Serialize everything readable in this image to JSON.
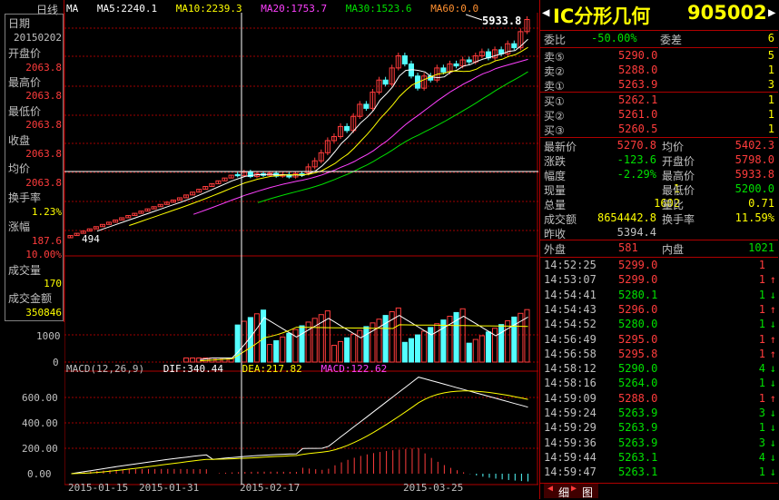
{
  "header": {
    "period_label": "日线",
    "ma_label": "MA",
    "ma5": "MA5:2240.1",
    "ma10": "MA10:2239.3",
    "ma20": "MA20:1753.7",
    "ma30": "MA30:1523.6",
    "ma60": "MA60:0.0",
    "high_marker": "5933.8",
    "low_marker": "494"
  },
  "left_panel": {
    "date_label": "日期",
    "date_value": "20150202",
    "open_label": "开盘价",
    "open_value": "2063.8",
    "high_label": "最高价",
    "high_value": "2063.8",
    "low_label": "最低价",
    "low_value": "2063.8",
    "close_label": "收盘",
    "close_value": "2063.8",
    "avg_label": "均价",
    "avg_value": "2063.8",
    "turnover_label": "换手率",
    "turnover_value": "1.23%",
    "change_label": "涨幅",
    "change_value": "187.6",
    "change_pct": "10.00%",
    "volume_label": "成交量",
    "volume_value": "170",
    "amount_label": "成交金额",
    "amount_value": "350846"
  },
  "volume_axis": [
    "1000",
    "0"
  ],
  "macd": {
    "label": "MACD(12,26,9)",
    "dif": "DIF:340.44",
    "dea": "DEA:217.82",
    "macd": "MACD:122.62",
    "axis": [
      "600.00",
      "400.00",
      "200.00",
      "0.00"
    ]
  },
  "date_axis": [
    "2015-01-15",
    "2015-01-31",
    "2015-02-17",
    "2015-03-25"
  ],
  "quote": {
    "name": "IC分形几何",
    "code": "905002",
    "webi_label": "委比",
    "webi_value": "-50.00%",
    "weicha_label": "委差",
    "weicha_value": "6",
    "asks": [
      {
        "label": "卖⑤",
        "price": "5290.0",
        "vol": "5"
      },
      {
        "label": "卖②",
        "price": "5288.0",
        "vol": "1"
      },
      {
        "label": "卖①",
        "price": "5263.9",
        "vol": "3"
      }
    ],
    "bids": [
      {
        "label": "买①",
        "price": "5262.1",
        "vol": "1"
      },
      {
        "label": "买②",
        "price": "5261.0",
        "vol": "1"
      },
      {
        "label": "买③",
        "price": "5260.5",
        "vol": "1"
      }
    ],
    "stats": [
      {
        "l1": "最新价",
        "v1": "5270.8",
        "l2": "均价",
        "v2": "5402.3"
      },
      {
        "l1": "涨跌",
        "v1": "-123.6",
        "l2": "开盘价",
        "v2": "5798.0"
      },
      {
        "l1": "幅度",
        "v1": "-2.29%",
        "l2": "最高价",
        "v2": "5933.8"
      },
      {
        "l1": "现量",
        "v1": "1",
        "l2": "最低价",
        "v2": "5200.0"
      },
      {
        "l1": "总量",
        "v1": "1602",
        "l2": "量比",
        "v2": "0.71"
      },
      {
        "l1": "成交额",
        "v1": "8654442.8",
        "l2": "换手率",
        "v2": "11.59%"
      },
      {
        "l1": "昨收",
        "v1": "5394.4",
        "l2": "",
        "v2": ""
      }
    ],
    "waipan_label": "外盘",
    "waipan_value": "581",
    "neipan_label": "内盘",
    "neipan_value": "1021",
    "ticks": [
      {
        "t": "14:52:25",
        "p": "5299.0",
        "v": "1",
        "d": ""
      },
      {
        "t": "14:53:07",
        "p": "5299.0",
        "v": "1",
        "d": "↑"
      },
      {
        "t": "14:54:41",
        "p": "5280.1",
        "v": "1",
        "d": "↓"
      },
      {
        "t": "14:54:43",
        "p": "5296.0",
        "v": "1",
        "d": "↑"
      },
      {
        "t": "14:54:52",
        "p": "5280.0",
        "v": "1",
        "d": "↓"
      },
      {
        "t": "14:56:49",
        "p": "5295.0",
        "v": "1",
        "d": "↑"
      },
      {
        "t": "14:56:58",
        "p": "5295.8",
        "v": "1",
        "d": "↑"
      },
      {
        "t": "14:58:12",
        "p": "5290.0",
        "v": "4",
        "d": "↓"
      },
      {
        "t": "14:58:16",
        "p": "5264.0",
        "v": "1",
        "d": "↓"
      },
      {
        "t": "14:59:09",
        "p": "5288.0",
        "v": "1",
        "d": "↑"
      },
      {
        "t": "14:59:24",
        "p": "5263.9",
        "v": "3",
        "d": "↓"
      },
      {
        "t": "14:59:29",
        "p": "5263.9",
        "v": "1",
        "d": "↓"
      },
      {
        "t": "14:59:36",
        "p": "5263.9",
        "v": "3",
        "d": "↓"
      },
      {
        "t": "14:59:44",
        "p": "5263.1",
        "v": "4",
        "d": "↓"
      },
      {
        "t": "14:59:47",
        "p": "5263.1",
        "v": "1",
        "d": "↓"
      }
    ],
    "bottom_tabs": [
      "细",
      "图"
    ]
  },
  "colors": {
    "up": "#ff3c3c",
    "down": "#54ffff",
    "ma5": "#ffffff",
    "ma10": "#ffff00",
    "ma20": "#ff40ff",
    "ma30": "#00e000",
    "grid": "#b00000"
  }
}
